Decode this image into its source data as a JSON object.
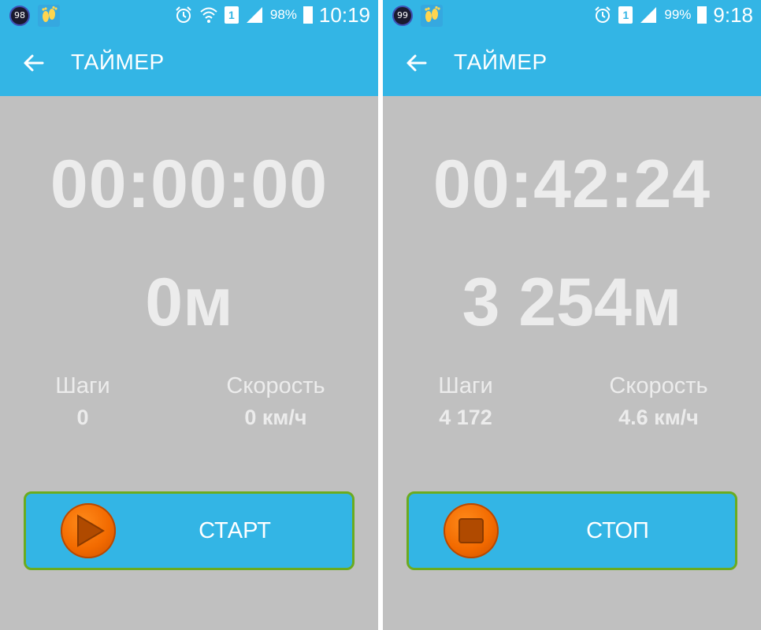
{
  "screens": [
    {
      "status_bar": {
        "badge": "98",
        "battery_pct": "98%",
        "time": "10:19",
        "sim": "1",
        "icons": [
          "steps-app-icon",
          "alarm-icon",
          "wifi-icon",
          "sim-icon",
          "signal-icon",
          "battery-icon"
        ]
      },
      "title": "ТАЙМЕР",
      "timer": "00:00:00",
      "distance": "0м",
      "steps_label": "Шаги",
      "steps_value": "0",
      "speed_label": "Скорость",
      "speed_value": "0 км/ч",
      "button_label": "СТАРТ",
      "button_icon": "play-icon"
    },
    {
      "status_bar": {
        "badge": "99",
        "battery_pct": "99%",
        "time": "9:18",
        "sim": "1",
        "icons": [
          "steps-app-icon",
          "alarm-icon",
          "sim-icon",
          "signal-icon",
          "battery-icon"
        ]
      },
      "title": "ТАЙМЕР",
      "timer": "00:42:24",
      "distance": "3 254м",
      "steps_label": "Шаги",
      "steps_value": "4 172",
      "speed_label": "Скорость",
      "speed_value": "4.6 км/ч",
      "button_label": "СТОП",
      "button_icon": "stop-icon"
    }
  ],
  "colors": {
    "accent": "#33b5e5",
    "background": "#c0c0c0",
    "text_light": "#ececec",
    "button_border": "#6bab1f",
    "button_icon": "#f26a00"
  }
}
